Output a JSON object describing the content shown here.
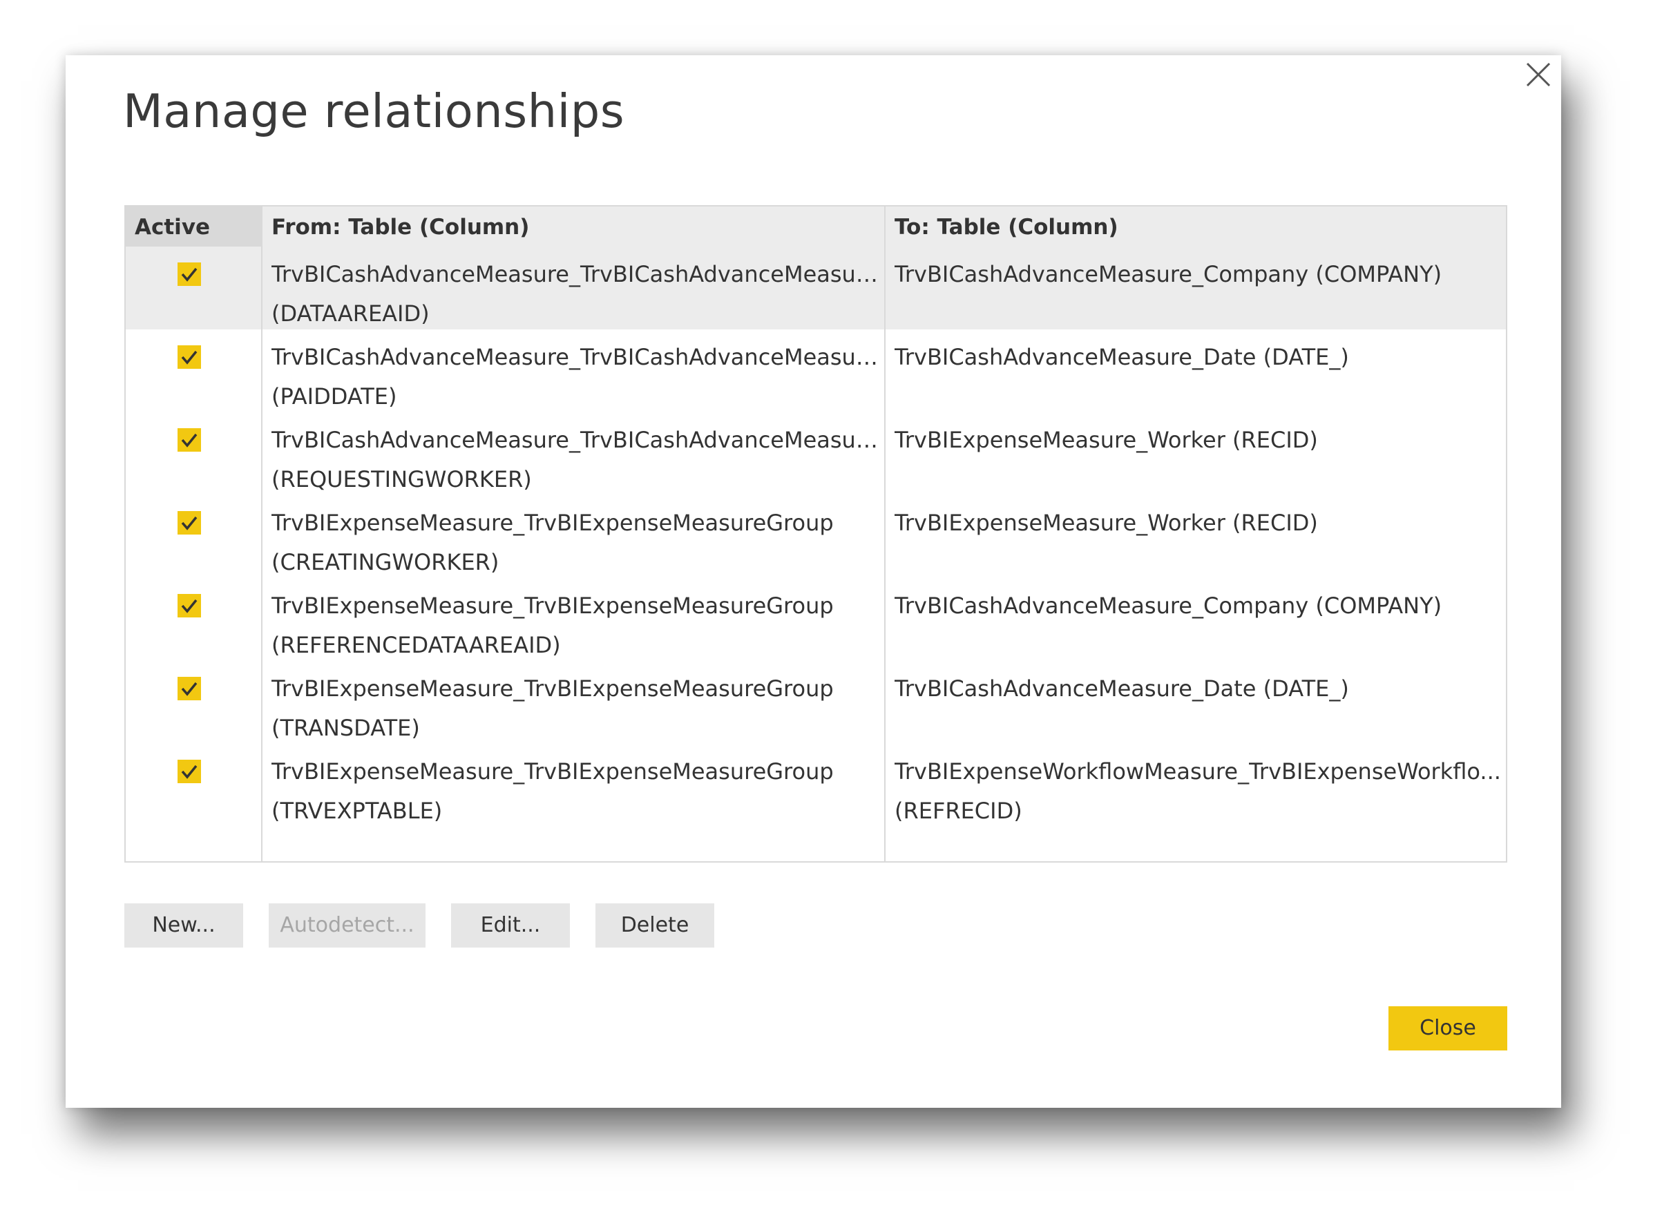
{
  "dialog": {
    "title": "Manage relationships",
    "close_icon": "close-icon"
  },
  "grid": {
    "headers": {
      "active": "Active",
      "from": "From: Table (Column)",
      "to": "To: Table (Column)"
    },
    "rows": [
      {
        "active": true,
        "selected": true,
        "from_line1": "TrvBICashAdvanceMeasure_TrvBICashAdvanceMeasure...",
        "from_line2": "(DATAAREAID)",
        "to_line1": "TrvBICashAdvanceMeasure_Company (COMPANY)",
        "to_line2": ""
      },
      {
        "active": true,
        "selected": false,
        "from_line1": "TrvBICashAdvanceMeasure_TrvBICashAdvanceMeasure...",
        "from_line2": "(PAIDDATE)",
        "to_line1": "TrvBICashAdvanceMeasure_Date (DATE_)",
        "to_line2": ""
      },
      {
        "active": true,
        "selected": false,
        "from_line1": "TrvBICashAdvanceMeasure_TrvBICashAdvanceMeasure...",
        "from_line2": "(REQUESTINGWORKER)",
        "to_line1": "TrvBIExpenseMeasure_Worker (RECID)",
        "to_line2": ""
      },
      {
        "active": true,
        "selected": false,
        "from_line1": "TrvBIExpenseMeasure_TrvBIExpenseMeasureGroup",
        "from_line2": "(CREATINGWORKER)",
        "to_line1": "TrvBIExpenseMeasure_Worker (RECID)",
        "to_line2": ""
      },
      {
        "active": true,
        "selected": false,
        "from_line1": "TrvBIExpenseMeasure_TrvBIExpenseMeasureGroup",
        "from_line2": "(REFERENCEDATAAREAID)",
        "to_line1": "TrvBICashAdvanceMeasure_Company (COMPANY)",
        "to_line2": ""
      },
      {
        "active": true,
        "selected": false,
        "from_line1": "TrvBIExpenseMeasure_TrvBIExpenseMeasureGroup",
        "from_line2": "(TRANSDATE)",
        "to_line1": "TrvBICashAdvanceMeasure_Date (DATE_)",
        "to_line2": ""
      },
      {
        "active": true,
        "selected": false,
        "from_line1": "TrvBIExpenseMeasure_TrvBIExpenseMeasureGroup",
        "from_line2": "(TRVEXPTABLE)",
        "to_line1": "TrvBIExpenseWorkflowMeasure_TrvBIExpenseWorkflo...",
        "to_line2": "(REFRECID)"
      }
    ]
  },
  "buttons": {
    "new": "New...",
    "autodetect": "Autodetect...",
    "edit": "Edit...",
    "delete": "Delete",
    "close": "Close"
  },
  "colors": {
    "accent": "#f2c811",
    "header_bg": "#ececec",
    "selected_row_bg": "#ececec"
  }
}
